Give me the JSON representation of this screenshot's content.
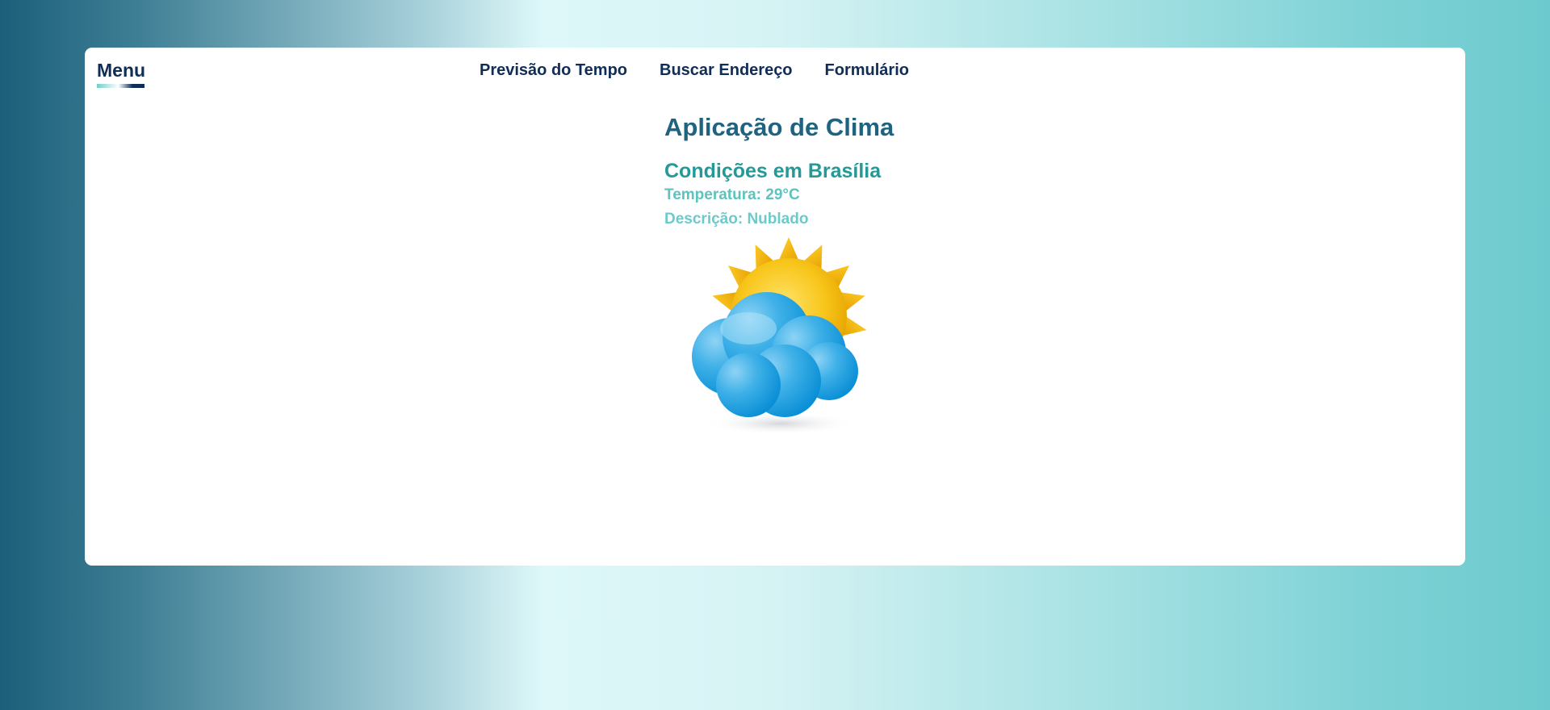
{
  "menu": {
    "title": "Menu"
  },
  "nav": {
    "items": [
      {
        "label": "Previsão do Tempo"
      },
      {
        "label": "Buscar Endereço"
      },
      {
        "label": "Formulário"
      }
    ]
  },
  "weather": {
    "app_title": "Aplicação de Clima",
    "city_heading": "Condições em Brasília",
    "temperature_line": "Temperatura: 29°C",
    "description_line": "Descrição: Nublado",
    "icon": "partly-cloudy-icon"
  },
  "colors": {
    "navy": "#0f2d55",
    "title": "#1e6380",
    "teal": "#239a98",
    "light_teal": "#5cc3bf"
  }
}
